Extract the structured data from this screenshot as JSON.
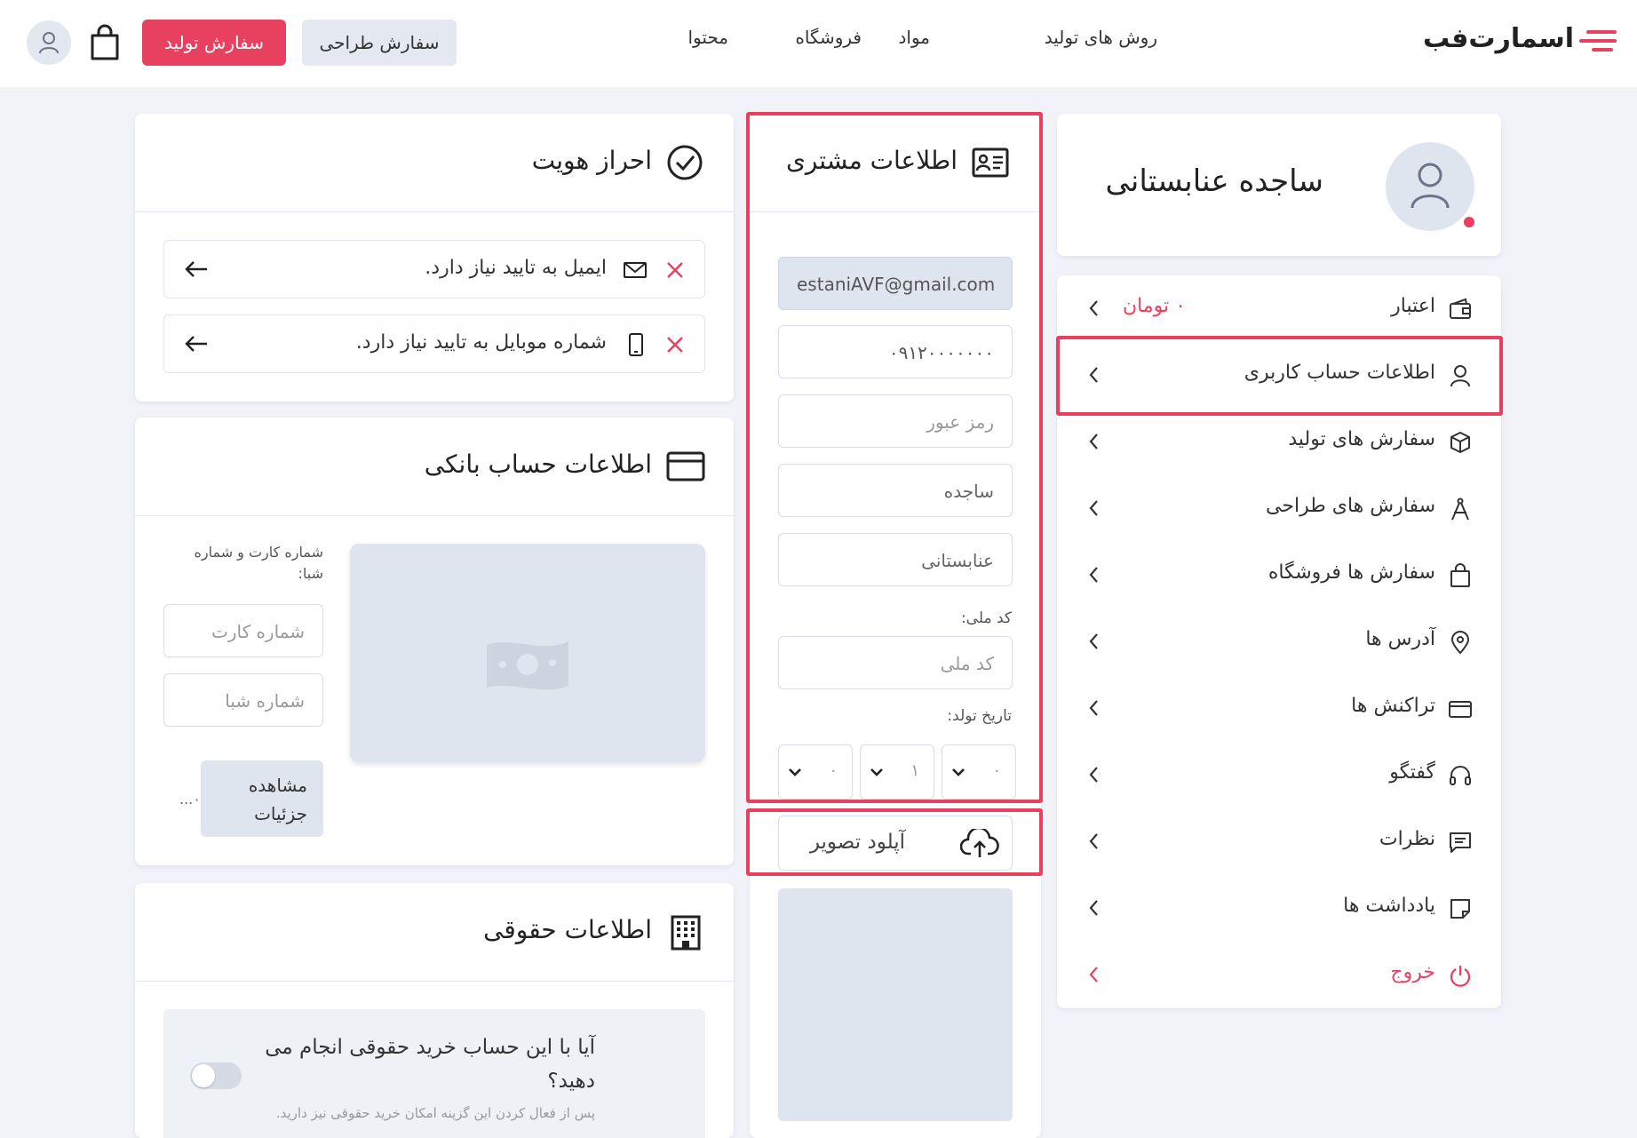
{
  "header": {
    "logo_text": "اسمارت‌فب",
    "nav": [
      "روش های تولید",
      "مواد",
      "فروشگاه",
      "محتوا"
    ],
    "design_order_button": "سفارش طراحی",
    "production_order_button": "سفارش تولید"
  },
  "profile": {
    "name": "ساجده عنابستانی"
  },
  "sidebar": {
    "credit_label": "اعتبار",
    "credit_value": "۰ تومان",
    "items": [
      {
        "label": "اطلاعات حساب کاربری",
        "icon": "user-icon"
      },
      {
        "label": "سفارش های تولید",
        "icon": "cube-icon"
      },
      {
        "label": "سفارش های طراحی",
        "icon": "compass-icon"
      },
      {
        "label": "سفارش ها فروشگاه",
        "icon": "shopping-bag-icon"
      },
      {
        "label": "آدرس ها",
        "icon": "location-pin-icon"
      },
      {
        "label": "تراکنش ها",
        "icon": "credit-card-icon"
      },
      {
        "label": "گفتگو",
        "icon": "headset-icon"
      },
      {
        "label": "نظرات",
        "icon": "comment-icon"
      },
      {
        "label": "یادداشت ها",
        "icon": "note-icon"
      }
    ],
    "logout_label": "خروج"
  },
  "customer": {
    "title": "اطلاعات مشتری",
    "email": "estaniAVF@gmail.com",
    "phone": "۰۹۱۲۰۰۰۰۰۰۰",
    "password_placeholder": "رمز عبور",
    "first_name": "ساجده",
    "last_name": "عنابستانی",
    "national_code_label": "کد ملی:",
    "national_code_placeholder": "کد ملی",
    "birth_date_label": "تاریخ تولد:",
    "birth_day": "۰",
    "birth_month": "۱",
    "birth_year": "۰",
    "upload_label": "آپلود تصویر"
  },
  "verification": {
    "title": "احراز هویت",
    "email_message": "ایمیل به تایید نیاز دارد.",
    "phone_message": "شماره موبایل به تایید نیاز دارد."
  },
  "bank": {
    "title": "اطلاعات حساب بانکی",
    "hint": "شماره کارت و شماره شبا:",
    "card_placeholder": "شماره کارت",
    "iban_placeholder": "شماره شبا",
    "details_button": "مشاهده جزئیات",
    "ellipsis": "...۰"
  },
  "legal": {
    "title": "اطلاعات حقوقی",
    "question": "آیا با این حساب خرید حقوقی انجام می دهید؟",
    "hint": "پس از فعال کردن این گزینه امکان خرید حقوقی نیز دارید."
  },
  "colors": {
    "accent": "#e8415f",
    "sidebar_highlight_border": "#e8415f",
    "field_disabled_bg": "#dfe5ef",
    "placeholder_box": "#dfe5ef"
  }
}
